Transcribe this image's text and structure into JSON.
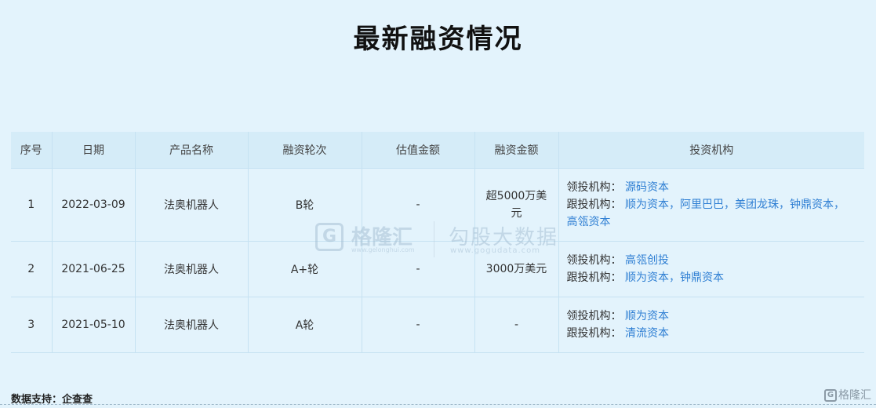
{
  "title": "最新融资情况",
  "table": {
    "headers": [
      "序号",
      "日期",
      "产品名称",
      "融资轮次",
      "估值金额",
      "融资金额",
      "投资机构"
    ],
    "rows": [
      {
        "index": "1",
        "date": "2022-03-09",
        "product": "法奥机器人",
        "round": "B轮",
        "valuation": "-",
        "amount_line1": "超5000万美",
        "amount_line2": "元",
        "lead_label": "领投机构：",
        "lead": "源码资本",
        "follow_label": "跟投机构：",
        "follow": "顺为资本，阿里巴巴，美团龙珠，钟鼎资本，",
        "follow_cont": "高瓴资本"
      },
      {
        "index": "2",
        "date": "2021-06-25",
        "product": "法奥机器人",
        "round": "A+轮",
        "valuation": "-",
        "amount_line1": "3000万美元",
        "amount_line2": "",
        "lead_label": "领投机构：",
        "lead": "高瓴创投",
        "follow_label": "跟投机构：",
        "follow": "顺为资本，钟鼎资本",
        "follow_cont": ""
      },
      {
        "index": "3",
        "date": "2021-05-10",
        "product": "法奥机器人",
        "round": "A轮",
        "valuation": "-",
        "amount_line1": "-",
        "amount_line2": "",
        "lead_label": "领投机构：",
        "lead": "顺为资本",
        "follow_label": "跟投机构：",
        "follow": "清流资本",
        "follow_cont": ""
      }
    ]
  },
  "watermark": {
    "logo_letter": "G",
    "name1": "格隆汇",
    "url1": "www.gelonghui.com",
    "name2": "勾股大数据",
    "url2": "www.gogudata.com"
  },
  "source": "数据支持：企查查",
  "corner_logo": {
    "letter": "G",
    "text": "格隆汇"
  }
}
